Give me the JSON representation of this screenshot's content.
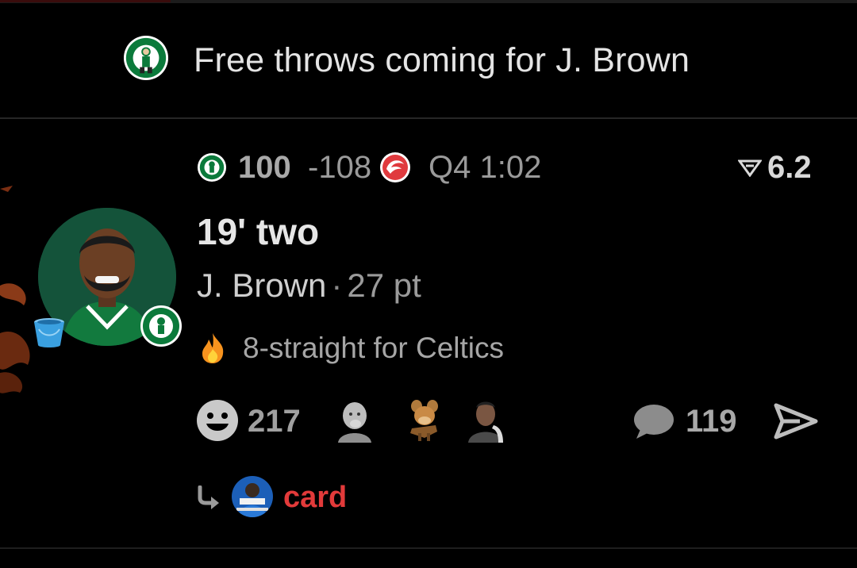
{
  "banner": {
    "text": "Free throws coming for J. Brown",
    "logo_icon": "celtics-logo"
  },
  "game": {
    "home_team_icon": "celtics-logo",
    "home_score": "100",
    "away_score": "-108",
    "away_team_icon": "hawks-logo",
    "clock": "Q4 1:02",
    "odds_icon": "odds-icon",
    "odds_value": "6.2"
  },
  "play": {
    "headline": "19' two",
    "player": "J. Brown",
    "separator": "·",
    "points": "27 pt",
    "streak_icon": "fire-icon",
    "streak_text": "8-straight for Celtics"
  },
  "actions": {
    "reaction_count": "217",
    "comment_count": "119"
  },
  "reply": {
    "label": "card"
  },
  "colors": {
    "background": "#000000",
    "text": "#d9d9d9",
    "muted": "#9a9a9a",
    "accent_red": "#e23a3a",
    "celtics_green": "#0b7a3b"
  }
}
